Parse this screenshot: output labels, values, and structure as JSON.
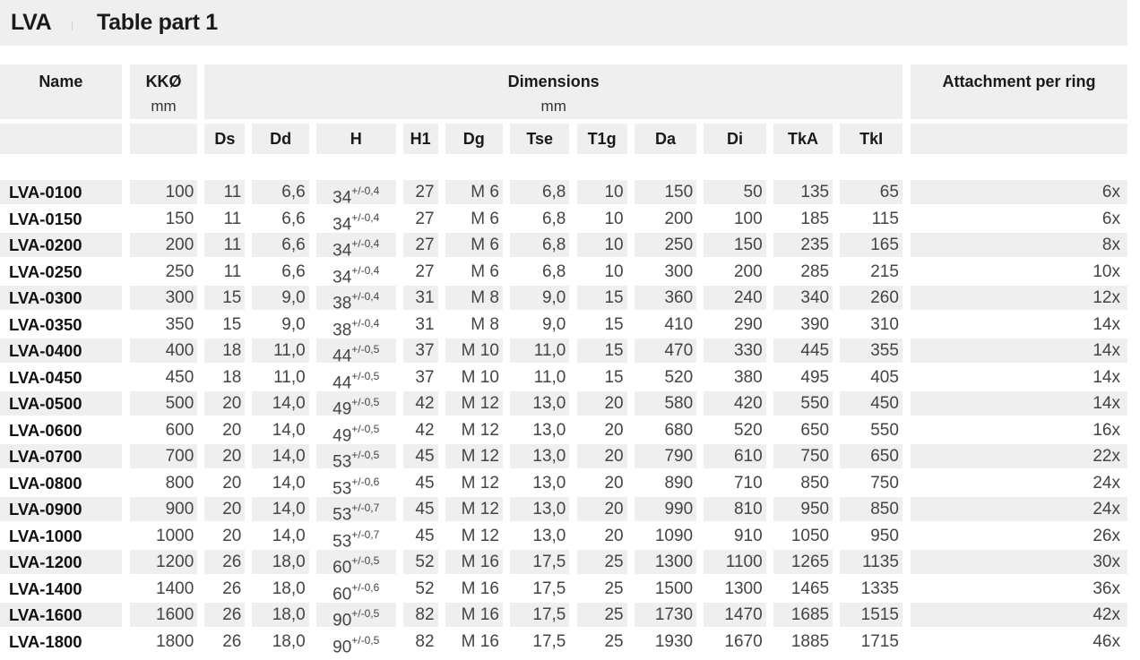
{
  "title": {
    "series": "LVA",
    "subtitle": "Table part 1"
  },
  "header": {
    "name": "Name",
    "kk": "KKØ",
    "kk_unit": "mm",
    "dimensions": "Dimensions",
    "dimensions_unit": "mm",
    "attachment": "Attachment per ring",
    "columns": [
      "Ds",
      "Dd",
      "H",
      "H1",
      "Dg",
      "Tse",
      "T1g",
      "Da",
      "Di",
      "TkA",
      "TkI"
    ]
  },
  "rows": [
    {
      "name": "LVA-0100",
      "kk": "100",
      "ds": "11",
      "dd": "6,6",
      "h": "34",
      "htol": "+/-0,4",
      "h1": "27",
      "dg": "M 6",
      "tse": "6,8",
      "t1g": "10",
      "da": "150",
      "di": "50",
      "tka": "135",
      "tki": "65",
      "att": "6x"
    },
    {
      "name": "LVA-0150",
      "kk": "150",
      "ds": "11",
      "dd": "6,6",
      "h": "34",
      "htol": "+/-0,4",
      "h1": "27",
      "dg": "M 6",
      "tse": "6,8",
      "t1g": "10",
      "da": "200",
      "di": "100",
      "tka": "185",
      "tki": "115",
      "att": "6x"
    },
    {
      "name": "LVA-0200",
      "kk": "200",
      "ds": "11",
      "dd": "6,6",
      "h": "34",
      "htol": "+/-0,4",
      "h1": "27",
      "dg": "M 6",
      "tse": "6,8",
      "t1g": "10",
      "da": "250",
      "di": "150",
      "tka": "235",
      "tki": "165",
      "att": "8x"
    },
    {
      "name": "LVA-0250",
      "kk": "250",
      "ds": "11",
      "dd": "6,6",
      "h": "34",
      "htol": "+/-0,4",
      "h1": "27",
      "dg": "M 6",
      "tse": "6,8",
      "t1g": "10",
      "da": "300",
      "di": "200",
      "tka": "285",
      "tki": "215",
      "att": "10x"
    },
    {
      "name": "LVA-0300",
      "kk": "300",
      "ds": "15",
      "dd": "9,0",
      "h": "38",
      "htol": "+/-0,4",
      "h1": "31",
      "dg": "M 8",
      "tse": "9,0",
      "t1g": "15",
      "da": "360",
      "di": "240",
      "tka": "340",
      "tki": "260",
      "att": "12x"
    },
    {
      "name": "LVA-0350",
      "kk": "350",
      "ds": "15",
      "dd": "9,0",
      "h": "38",
      "htol": "+/-0,4",
      "h1": "31",
      "dg": "M 8",
      "tse": "9,0",
      "t1g": "15",
      "da": "410",
      "di": "290",
      "tka": "390",
      "tki": "310",
      "att": "14x"
    },
    {
      "name": "LVA-0400",
      "kk": "400",
      "ds": "18",
      "dd": "11,0",
      "h": "44",
      "htol": "+/-0,5",
      "h1": "37",
      "dg": "M 10",
      "tse": "11,0",
      "t1g": "15",
      "da": "470",
      "di": "330",
      "tka": "445",
      "tki": "355",
      "att": "14x"
    },
    {
      "name": "LVA-0450",
      "kk": "450",
      "ds": "18",
      "dd": "11,0",
      "h": "44",
      "htol": "+/-0,5",
      "h1": "37",
      "dg": "M 10",
      "tse": "11,0",
      "t1g": "15",
      "da": "520",
      "di": "380",
      "tka": "495",
      "tki": "405",
      "att": "14x"
    },
    {
      "name": "LVA-0500",
      "kk": "500",
      "ds": "20",
      "dd": "14,0",
      "h": "49",
      "htol": "+/-0,5",
      "h1": "42",
      "dg": "M 12",
      "tse": "13,0",
      "t1g": "20",
      "da": "580",
      "di": "420",
      "tka": "550",
      "tki": "450",
      "att": "14x"
    },
    {
      "name": "LVA-0600",
      "kk": "600",
      "ds": "20",
      "dd": "14,0",
      "h": "49",
      "htol": "+/-0,5",
      "h1": "42",
      "dg": "M 12",
      "tse": "13,0",
      "t1g": "20",
      "da": "680",
      "di": "520",
      "tka": "650",
      "tki": "550",
      "att": "16x"
    },
    {
      "name": "LVA-0700",
      "kk": "700",
      "ds": "20",
      "dd": "14,0",
      "h": "53",
      "htol": "+/-0,5",
      "h1": "45",
      "dg": "M 12",
      "tse": "13,0",
      "t1g": "20",
      "da": "790",
      "di": "610",
      "tka": "750",
      "tki": "650",
      "att": "22x"
    },
    {
      "name": "LVA-0800",
      "kk": "800",
      "ds": "20",
      "dd": "14,0",
      "h": "53",
      "htol": "+/-0,6",
      "h1": "45",
      "dg": "M 12",
      "tse": "13,0",
      "t1g": "20",
      "da": "890",
      "di": "710",
      "tka": "850",
      "tki": "750",
      "att": "24x"
    },
    {
      "name": "LVA-0900",
      "kk": "900",
      "ds": "20",
      "dd": "14,0",
      "h": "53",
      "htol": "+/-0,7",
      "h1": "45",
      "dg": "M 12",
      "tse": "13,0",
      "t1g": "20",
      "da": "990",
      "di": "810",
      "tka": "950",
      "tki": "850",
      "att": "24x"
    },
    {
      "name": "LVA-1000",
      "kk": "1000",
      "ds": "20",
      "dd": "14,0",
      "h": "53",
      "htol": "+/-0,7",
      "h1": "45",
      "dg": "M 12",
      "tse": "13,0",
      "t1g": "20",
      "da": "1090",
      "di": "910",
      "tka": "1050",
      "tki": "950",
      "att": "26x"
    },
    {
      "name": "LVA-1200",
      "kk": "1200",
      "ds": "26",
      "dd": "18,0",
      "h": "60",
      "htol": "+/-0,5",
      "h1": "52",
      "dg": "M 16",
      "tse": "17,5",
      "t1g": "25",
      "da": "1300",
      "di": "1100",
      "tka": "1265",
      "tki": "1135",
      "att": "30x"
    },
    {
      "name": "LVA-1400",
      "kk": "1400",
      "ds": "26",
      "dd": "18,0",
      "h": "60",
      "htol": "+/-0,6",
      "h1": "52",
      "dg": "M 16",
      "tse": "17,5",
      "t1g": "25",
      "da": "1500",
      "di": "1300",
      "tka": "1465",
      "tki": "1335",
      "att": "36x"
    },
    {
      "name": "LVA-1600",
      "kk": "1600",
      "ds": "26",
      "dd": "18,0",
      "h": "90",
      "htol": "+/-0,5",
      "h1": "82",
      "dg": "M 16",
      "tse": "17,5",
      "t1g": "25",
      "da": "1730",
      "di": "1470",
      "tka": "1685",
      "tki": "1515",
      "att": "42x"
    },
    {
      "name": "LVA-1800",
      "kk": "1800",
      "ds": "26",
      "dd": "18,0",
      "h": "90",
      "htol": "+/-0,5",
      "h1": "82",
      "dg": "M 16",
      "tse": "17,5",
      "t1g": "25",
      "da": "1930",
      "di": "1670",
      "tka": "1885",
      "tki": "1715",
      "att": "46x"
    }
  ]
}
